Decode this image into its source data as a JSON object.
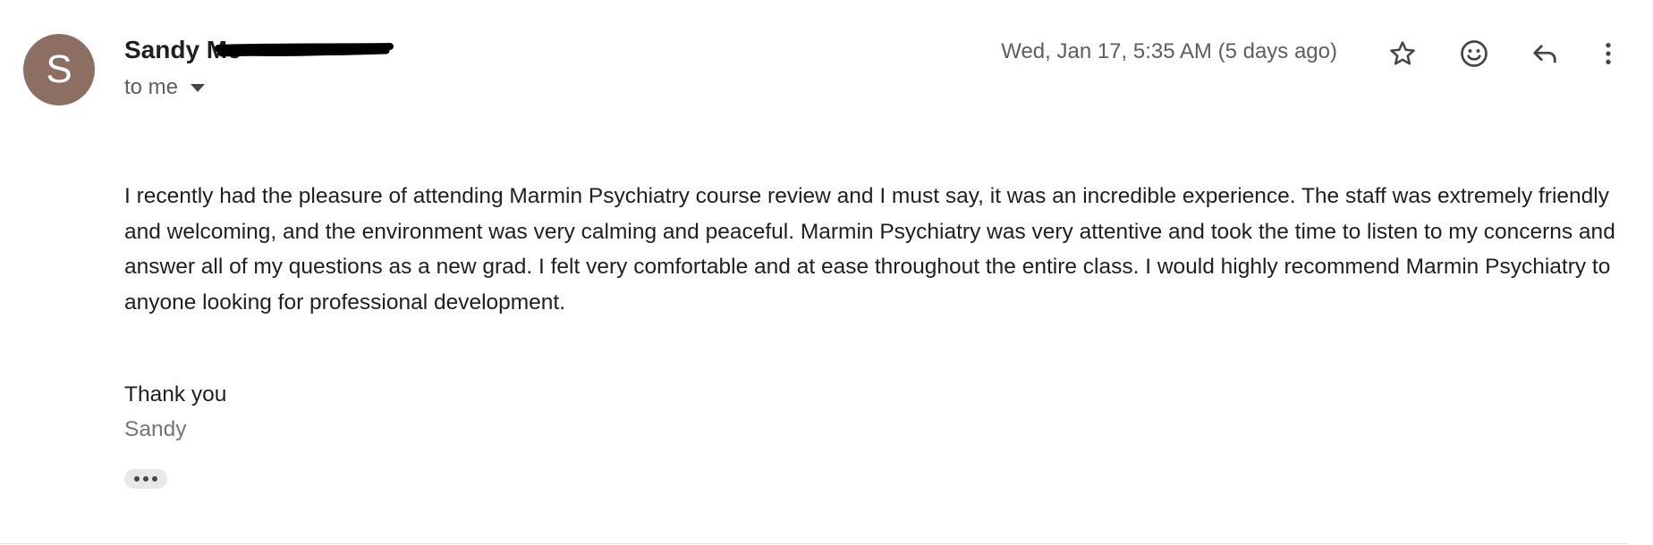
{
  "sender": {
    "avatar_letter": "S",
    "avatar_color": "#8d6e63",
    "name": "Sandy Mc"
  },
  "recipient": {
    "label": "to me"
  },
  "timestamp": "Wed, Jan 17, 5:35 AM (5 days ago)",
  "actions": {
    "star_icon": "star-outline-icon",
    "emoji_icon": "add-reaction-icon",
    "reply_icon": "reply-icon",
    "more_icon": "more-vert-icon"
  },
  "message": {
    "body": "I recently had the pleasure of attending Marmin Psychiatry course review and I must say, it was an incredible experience. The staff was extremely friendly and welcoming, and the environment was very calming and peaceful. Marmin Psychiatry was very attentive and took the time to listen to my concerns and answer all of my questions as a new grad. I felt very comfortable and at ease throughout the entire class. I would highly recommend Marmin Psychiatry to anyone looking for professional development.",
    "closing": "Thank you",
    "signature": "Sandy"
  },
  "trimmed_content_icon": "more-horiz-icon"
}
